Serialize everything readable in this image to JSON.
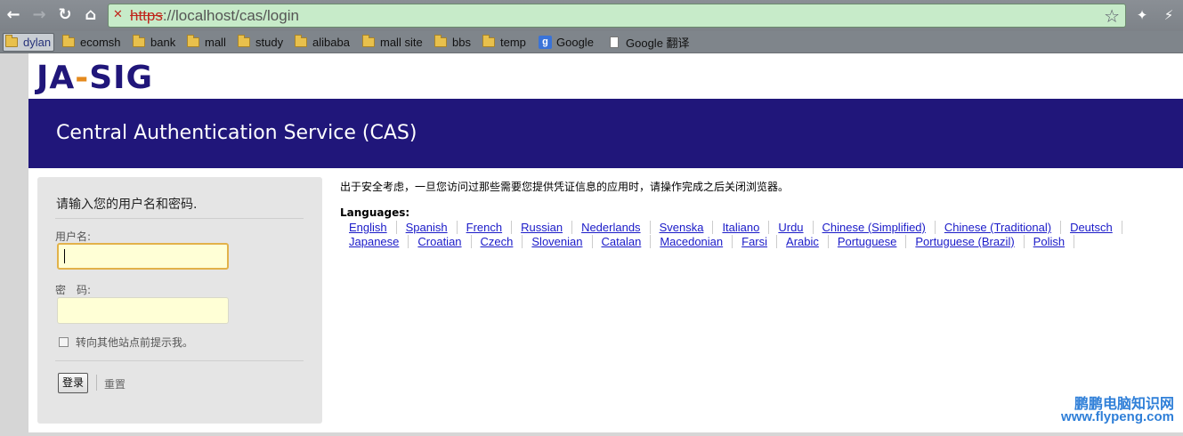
{
  "browser": {
    "url_scheme": "https",
    "url_rest": "://localhost/cas/login",
    "url_host": "localhost",
    "url_path": "/cas/login",
    "bookmarks": [
      {
        "label": "dylan",
        "icon": "folder-icon"
      },
      {
        "label": "ecomsh",
        "icon": "folder-icon"
      },
      {
        "label": "bank",
        "icon": "folder-icon"
      },
      {
        "label": "mall",
        "icon": "folder-icon"
      },
      {
        "label": "study",
        "icon": "folder-icon"
      },
      {
        "label": "alibaba",
        "icon": "folder-icon"
      },
      {
        "label": "mall site",
        "icon": "folder-icon"
      },
      {
        "label": "bbs",
        "icon": "folder-icon"
      },
      {
        "label": "temp",
        "icon": "folder-icon"
      },
      {
        "label": "Google",
        "icon": "google-icon"
      },
      {
        "label": "Google 翻译",
        "icon": "page-icon"
      }
    ]
  },
  "page": {
    "logo": {
      "part1": "JA",
      "dash": "-",
      "part2": "SIG"
    },
    "banner_title": "Central Authentication Service (CAS)",
    "login": {
      "heading": "请输入您的用户名和密码.",
      "username_label": "用户名:",
      "username_value": "",
      "password_label": "密　码:",
      "password_value": "",
      "warn_label": "转向其他站点前提示我。",
      "submit_label": "登录",
      "reset_label": "重置"
    },
    "notice": "出于安全考虑，一旦您访问过那些需要您提供凭证信息的应用时，请操作完成之后关闭浏览器。",
    "languages_title": "Languages:",
    "languages_row1": [
      "English",
      "Spanish",
      "French",
      "Russian",
      "Nederlands",
      "Svenska",
      "Italiano",
      "Urdu",
      "Chinese (Simplified)",
      "Chinese (Traditional)",
      "Deutsch"
    ],
    "languages_row2": [
      "Japanese",
      "Croatian",
      "Czech",
      "Slovenian",
      "Catalan",
      "Macedonian",
      "Farsi",
      "Arabic",
      "Portuguese",
      "Portuguese (Brazil)",
      "Polish"
    ]
  },
  "watermark": {
    "line1": "鹏鹏电脑知识网",
    "line2": "www.flypeng.com"
  },
  "colors": {
    "banner": "#20167a",
    "logo_accent": "#e58a1d",
    "link": "#1a1ac8",
    "omnibox": "#c7ebc9"
  }
}
